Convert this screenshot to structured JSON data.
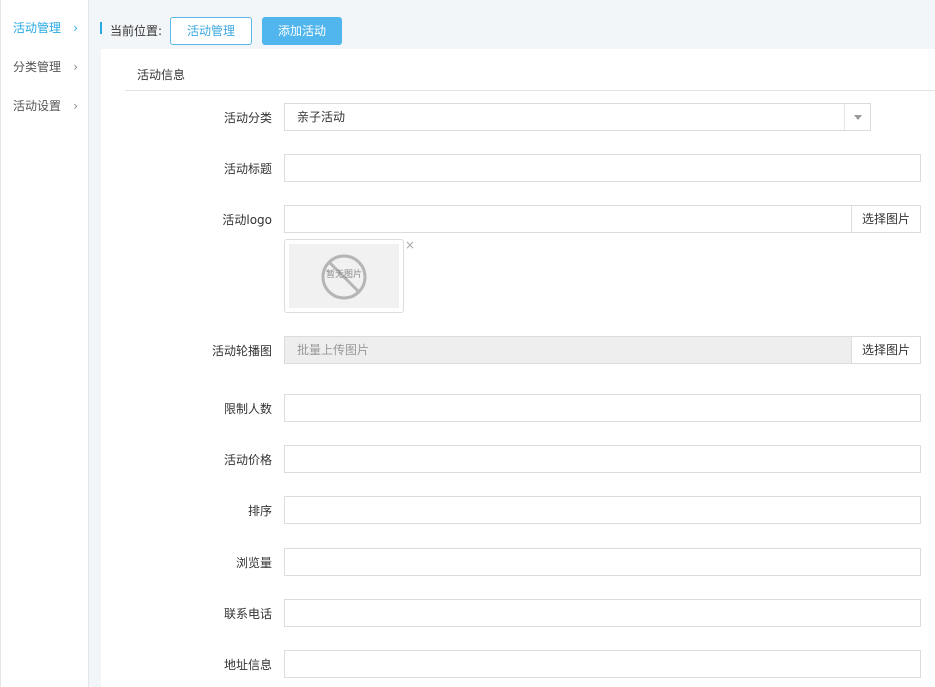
{
  "sidebar": {
    "items": [
      {
        "label": "活动管理",
        "chevron": "›"
      },
      {
        "label": "分类管理",
        "chevron": "›"
      },
      {
        "label": "活动设置",
        "chevron": "›"
      }
    ]
  },
  "breadcrumb": {
    "label": "当前位置:",
    "link_label": "活动管理",
    "action_label": "添加活动"
  },
  "form": {
    "section_title": "活动信息",
    "category": {
      "label": "活动分类",
      "value": "亲子活动"
    },
    "title": {
      "label": "活动标题",
      "value": ""
    },
    "logo": {
      "label": "活动logo",
      "value": "",
      "button": "选择图片",
      "no_image_text": "暂无图片",
      "remove_glyph": "×"
    },
    "carousel": {
      "label": "活动轮播图",
      "placeholder": "批量上传图片",
      "button": "选择图片"
    },
    "limit": {
      "label": "限制人数",
      "value": ""
    },
    "price": {
      "label": "活动价格",
      "value": ""
    },
    "sort": {
      "label": "排序",
      "value": ""
    },
    "views": {
      "label": "浏览量",
      "value": ""
    },
    "phone": {
      "label": "联系电话",
      "value": ""
    },
    "address": {
      "label": "地址信息",
      "value": ""
    }
  },
  "colors": {
    "accent": "#27a9e3",
    "primary_button": "#51b6ee"
  }
}
